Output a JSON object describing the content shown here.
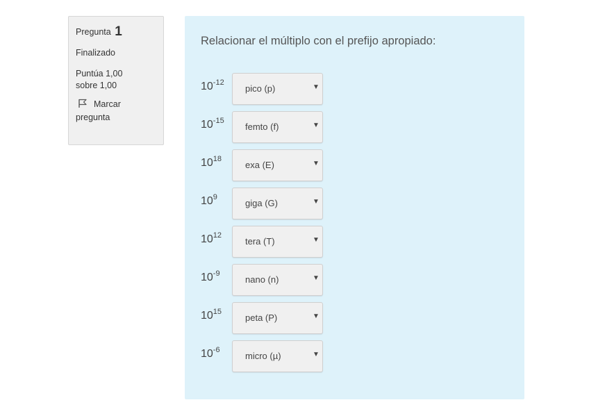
{
  "info": {
    "question_label": "Pregunta",
    "question_number": "1",
    "state": "Finalizado",
    "grade": "Puntúa 1,00 sobre 1,00",
    "flag_label": "Marcar pregunta"
  },
  "question": {
    "text": "Relacionar el múltiplo con el prefijo apropiado:",
    "rows": [
      {
        "base": "10",
        "exponent": "-12",
        "selected": "pico (p)"
      },
      {
        "base": "10",
        "exponent": "-15",
        "selected": "femto (f)"
      },
      {
        "base": "10",
        "exponent": "18",
        "selected": "exa (E)"
      },
      {
        "base": "10",
        "exponent": "9",
        "selected": "giga (G)"
      },
      {
        "base": "10",
        "exponent": "12",
        "selected": "tera (T)"
      },
      {
        "base": "10",
        "exponent": "-9",
        "selected": "nano (n)"
      },
      {
        "base": "10",
        "exponent": "15",
        "selected": "peta (P)"
      },
      {
        "base": "10",
        "exponent": "-6",
        "selected": "micro (µ)"
      }
    ]
  },
  "icons": {
    "flag": "flag-icon",
    "dropdown": "caret-down-icon"
  }
}
